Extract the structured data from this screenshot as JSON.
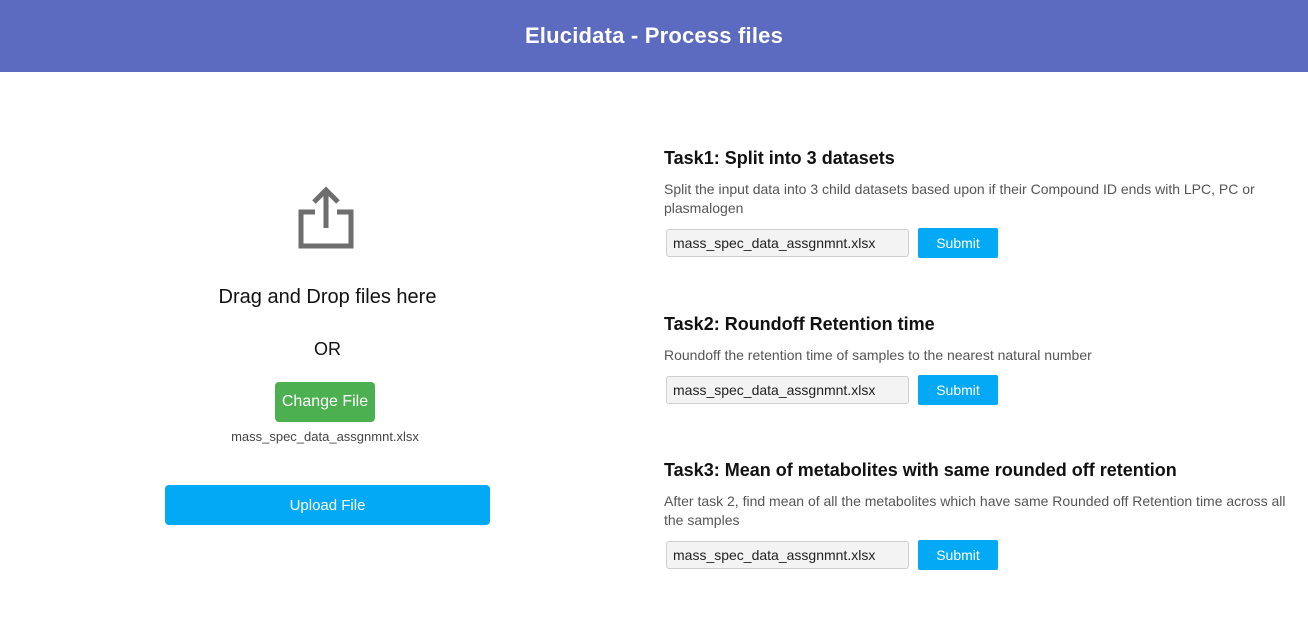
{
  "header": {
    "title": "Elucidata - Process files"
  },
  "upload": {
    "icon": "share-upload-icon",
    "drag_text": "Drag and Drop files here",
    "or_text": "OR",
    "change_label": "Change File",
    "file_name": "mass_spec_data_assgnmnt.xlsx",
    "upload_label": "Upload File"
  },
  "tasks": [
    {
      "title": "Task1: Split into 3 datasets",
      "description": "Split the input data into 3 child datasets based upon if their Compound ID ends with LPC, PC or plasmalogen",
      "file_value": "mass_spec_data_assgnmnt.xlsx",
      "submit_label": "Submit"
    },
    {
      "title": "Task2: Roundoff Retention time",
      "description": "Roundoff the retention time of samples to the nearest natural number",
      "file_value": "mass_spec_data_assgnmnt.xlsx",
      "submit_label": "Submit"
    },
    {
      "title": "Task3: Mean of metabolites with same rounded off retention",
      "description": "After task 2, find mean of all the metabolites which have same Rounded off Retention time across all the samples",
      "file_value": "mass_spec_data_assgnmnt.xlsx",
      "submit_label": "Submit"
    }
  ],
  "colors": {
    "header": "#5c6bc0",
    "change_button": "#4caf50",
    "primary_button": "#03a9f4"
  }
}
